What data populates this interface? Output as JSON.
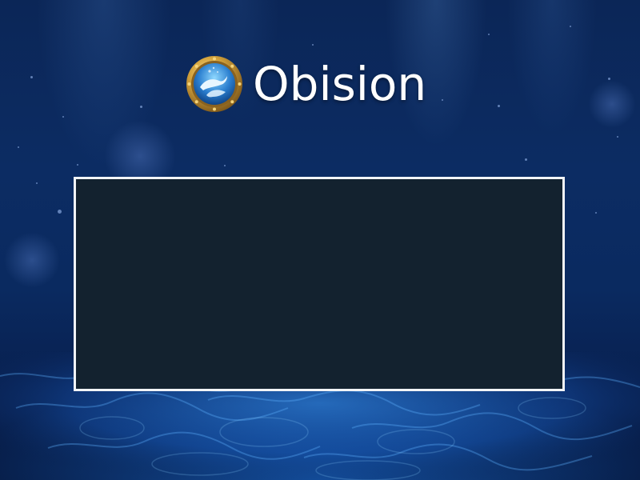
{
  "screen": {
    "type": "boot-splash",
    "background_color": "#0b2657",
    "accent_color": "#2a7de1"
  },
  "branding": {
    "name": "Obision",
    "logo_icon": "porthole-dolphins-icon"
  },
  "panel": {
    "background_color": "#13222f",
    "border_color": "#f2f4f7",
    "content": ""
  }
}
